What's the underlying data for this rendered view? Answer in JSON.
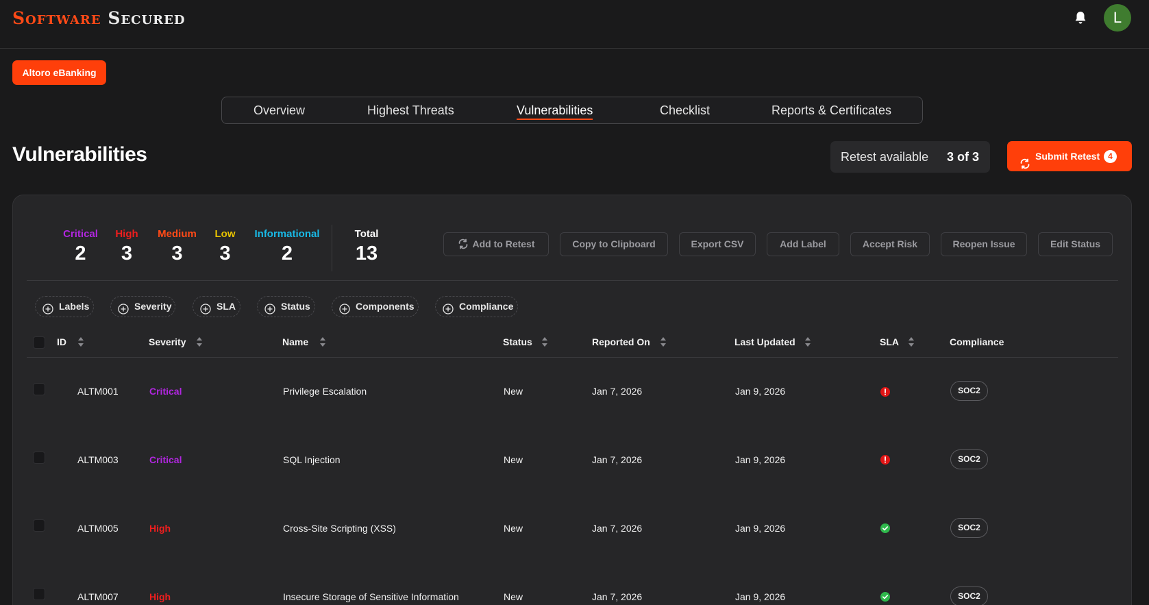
{
  "header": {
    "logo_part1": "Software",
    "logo_part2": "Secured",
    "avatar_initial": "L",
    "brand_color": "#ff4a17"
  },
  "project": {
    "label": "Altoro eBanking"
  },
  "tabs": [
    {
      "label": "Overview",
      "active": false
    },
    {
      "label": "Highest Threats",
      "active": false
    },
    {
      "label": "Vulnerabilities",
      "active": true
    },
    {
      "label": "Checklist",
      "active": false
    },
    {
      "label": "Reports & Certificates",
      "active": false
    }
  ],
  "page": {
    "title": "Vulnerabilities"
  },
  "retest": {
    "label": "Retest available",
    "count": "3 of 3"
  },
  "submit_retest": {
    "label": "Submit Retest",
    "badge": "4"
  },
  "stats": [
    {
      "label": "Critical",
      "value": "2",
      "color": "#b126e0"
    },
    {
      "label": "High",
      "value": "3",
      "color": "#f01e1e"
    },
    {
      "label": "Medium",
      "value": "3",
      "color": "#ff4a17"
    },
    {
      "label": "Low",
      "value": "3",
      "color": "#e8c300"
    },
    {
      "label": "Informational",
      "value": "2",
      "color": "#19b9e6"
    },
    {
      "label": "Total",
      "value": "13",
      "color": "#ffffff"
    }
  ],
  "actions": [
    "Add to Retest",
    "Copy to Clipboard",
    "Export CSV",
    "Add Label",
    "Accept Risk",
    "Reopen Issue",
    "Edit Status"
  ],
  "filters": [
    "Labels",
    "Severity",
    "SLA",
    "Status",
    "Components",
    "Compliance"
  ],
  "table": {
    "headers": [
      "ID",
      "Severity",
      "Name",
      "Status",
      "Reported On",
      "Last Updated",
      "SLA",
      "Compliance"
    ],
    "rows": [
      {
        "id": "ALTM001",
        "severity": "Critical",
        "severity_color": "#b126e0",
        "name": "Privilege Escalation",
        "status": "New",
        "reported": "Jan 7, 2026",
        "updated": "Jan 9, 2026",
        "sla": "breached",
        "compliance": "SOC2"
      },
      {
        "id": "ALTM003",
        "severity": "Critical",
        "severity_color": "#b126e0",
        "name": "SQL Injection",
        "status": "New",
        "reported": "Jan 7, 2026",
        "updated": "Jan 9, 2026",
        "sla": "breached",
        "compliance": "SOC2"
      },
      {
        "id": "ALTM005",
        "severity": "High",
        "severity_color": "#f01e1e",
        "name": "Cross-Site Scripting (XSS)",
        "status": "New",
        "reported": "Jan 7, 2026",
        "updated": "Jan 9, 2026",
        "sla": "ok",
        "compliance": "SOC2"
      },
      {
        "id": "ALTM007",
        "severity": "High",
        "severity_color": "#f01e1e",
        "name": "Insecure Storage of Sensitive Information",
        "status": "New",
        "reported": "Jan 7, 2026",
        "updated": "Jan 9, 2026",
        "sla": "ok",
        "compliance": "SOC2"
      }
    ]
  }
}
